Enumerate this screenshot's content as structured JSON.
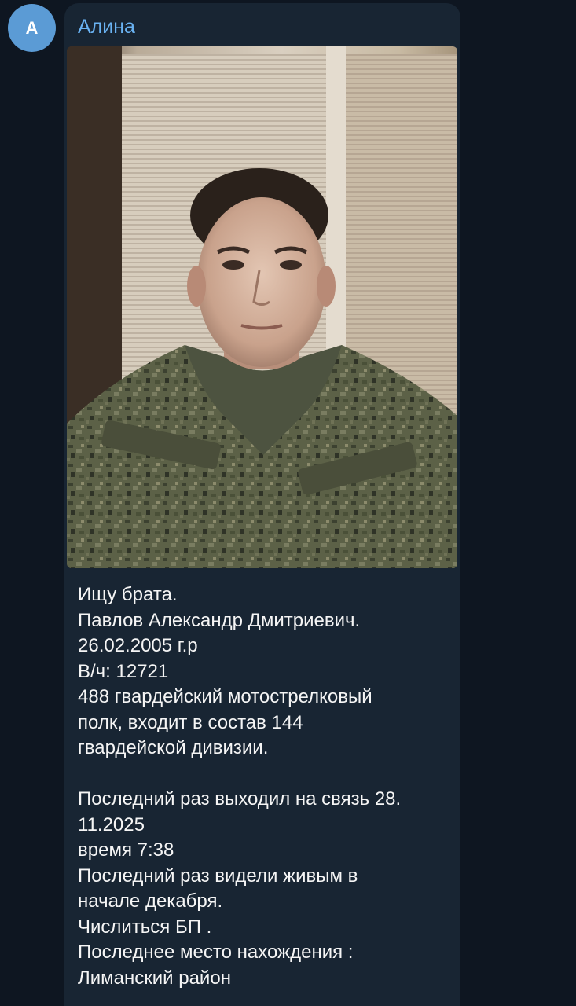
{
  "chat": {
    "avatar_letter": "А",
    "sender_name": "Алина",
    "colors": {
      "background": "#0e1621",
      "bubble": "#182533",
      "sender": "#6ab3f3",
      "avatar": "#5b9bd5",
      "text": "#f5f5f5"
    }
  },
  "message": {
    "photo_icon": "portrait-photo",
    "lines": [
      "Ищу брата.",
      "Павлов Александр Дмитриевич.",
      "26.02.2005 г.р",
      "В/ч: 12721",
      "488 гвардейский мотострелковый",
      "полк, входит в состав 144",
      "гвардейской дивизии.",
      "",
      "Последний раз выходил на связь 28.",
      "11.2025",
      "время 7:38",
      "Последний раз видели живым в",
      "начале декабря.",
      "Числиться БП .",
      "Последнее место нахождения :",
      "Лиманский район"
    ]
  }
}
